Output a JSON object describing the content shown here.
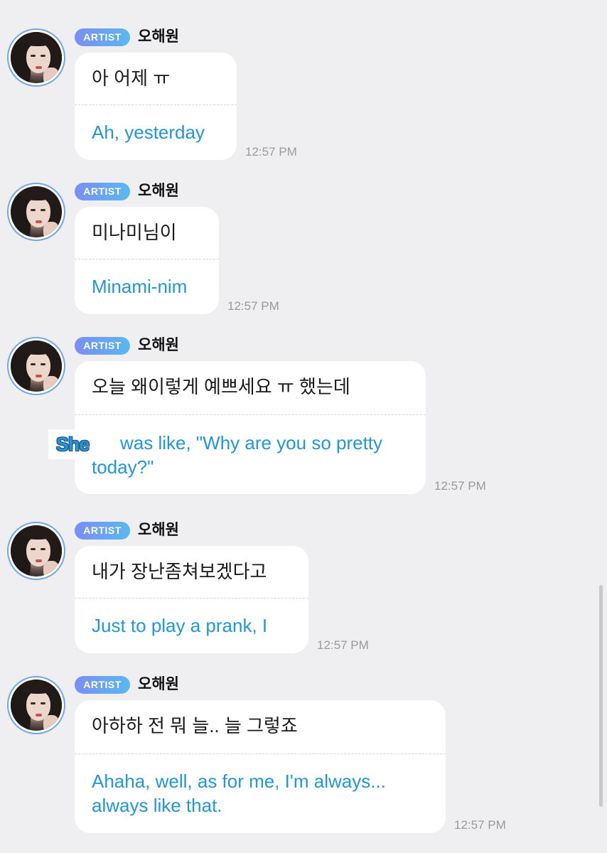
{
  "messages": [
    {
      "badge": "ARTIST",
      "author": "오해원",
      "korean": "아 어제 ㅠ",
      "translation": "Ah, yesterday",
      "time": "12:57 PM"
    },
    {
      "badge": "ARTIST",
      "author": "오해원",
      "korean": "미나미님이",
      "translation": "Minami-nim",
      "time": "12:57 PM"
    },
    {
      "badge": "ARTIST",
      "author": "오해원",
      "korean": "오늘 왜이렇게 예쁘세요 ㅠ 했는데",
      "translation": "was like, \"Why are you so pretty today?\"",
      "time": "12:57 PM",
      "overlay_label": "She"
    },
    {
      "badge": "ARTIST",
      "author": "오해원",
      "korean": "내가 장난좀쳐보겠다고",
      "translation": "Just to play a prank, I",
      "time": "12:57 PM"
    },
    {
      "badge": "ARTIST",
      "author": "오해원",
      "korean": "아하하 전 뭐 늘.. 늘 그렇죠",
      "translation": "Ahaha, well, as for me, I'm always... always like that.",
      "time": "12:57 PM"
    }
  ],
  "colors": {
    "background": "#efeff1",
    "bubble": "#ffffff",
    "translation_text": "#2096dc",
    "timestamp": "#9a9a9e",
    "badge_gradient_start": "#7a8ef5",
    "badge_gradient_end": "#5ab8f0"
  },
  "icons": {
    "avatar": "profile-photo-avatar"
  }
}
